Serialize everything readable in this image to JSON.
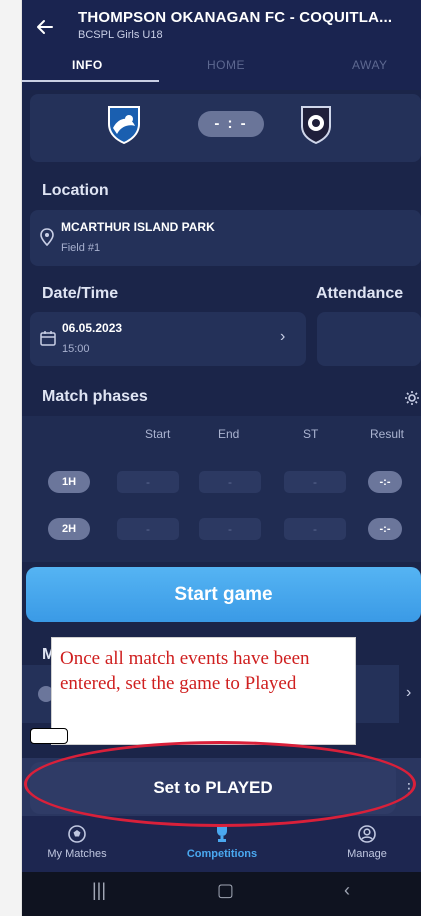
{
  "header": {
    "title": "THOMPSON OKANAGAN FC - COQUITLA...",
    "subtitle": "BCSPL Girls U18"
  },
  "tabs": [
    {
      "label": "INFO",
      "active": true
    },
    {
      "label": "HOME",
      "active": false
    },
    {
      "label": "AWAY",
      "active": false
    }
  ],
  "score": {
    "display": "- : -"
  },
  "location": {
    "section_label": "Location",
    "venue": "MCARTHUR ISLAND PARK",
    "field": "Field #1"
  },
  "datetime": {
    "section_label": "Date/Time",
    "date": "06.05.2023",
    "time": "15:00"
  },
  "attendance": {
    "section_label": "Attendance"
  },
  "match_phases": {
    "section_label": "Match phases",
    "columns": [
      "Start",
      "End",
      "ST",
      "Result"
    ],
    "rows": [
      {
        "phase": "1H",
        "start": "-",
        "end": "-",
        "st": "-",
        "result": "-:-"
      },
      {
        "phase": "2H",
        "start": "-",
        "end": "-",
        "st": "-",
        "result": "-:-"
      }
    ]
  },
  "buttons": {
    "start_game": "Start game",
    "set_played": "Set to PLAYED"
  },
  "partial_section_letter": "M",
  "annotation": {
    "text": "Once all match events have been entered, set the game to Played"
  },
  "bottom_nav": [
    {
      "label": "My Matches",
      "icon": "soccer-ball-icon",
      "active": false
    },
    {
      "label": "Competitions",
      "icon": "trophy-icon",
      "active": true
    },
    {
      "label": "Manage",
      "icon": "profile-icon",
      "active": false
    }
  ],
  "colors": {
    "background": "#1b2549",
    "accent": "#4aa8f0",
    "annotation_red": "#d9203a"
  }
}
